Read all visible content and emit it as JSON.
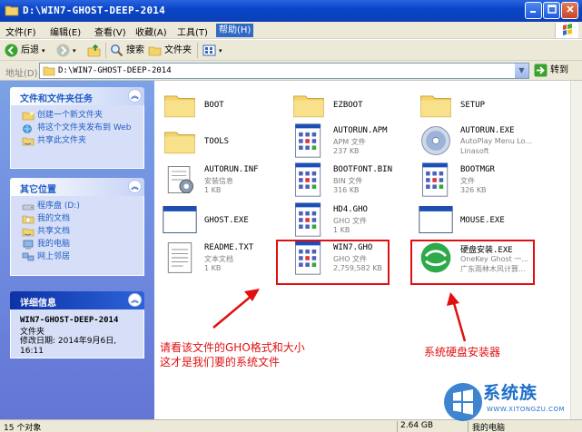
{
  "window": {
    "title": "D:\\WIN7-GHOST-DEEP-2014"
  },
  "menu": [
    "文件(F)",
    "编辑(E)",
    "查看(V)",
    "收藏(A)",
    "工具(T)",
    "帮助(H)"
  ],
  "toolbar": {
    "back": "后退",
    "search": "搜索",
    "folders": "文件夹"
  },
  "address": {
    "label": "地址(D)",
    "value": "D:\\WIN7-GHOST-DEEP-2014",
    "go": "转到"
  },
  "sidebar": {
    "tasks": {
      "title": "文件和文件夹任务",
      "items": [
        "创建一个新文件夹",
        "将这个文件夹发布到 Web",
        "共享此文件夹"
      ],
      "icons": [
        "new-folder-icon",
        "publish-web-icon",
        "share-folder-icon"
      ]
    },
    "places": {
      "title": "其它位置",
      "items": [
        "程序盘 (D:)",
        "我的文档",
        "共享文档",
        "我的电脑",
        "网上邻居"
      ],
      "icons": [
        "drive-icon",
        "my-documents-icon",
        "shared-documents-icon",
        "my-computer-icon",
        "network-places-icon"
      ]
    },
    "details": {
      "title": "详细信息",
      "name": "WIN7-GHOST-DEEP-2014",
      "type": "文件夹",
      "modified": "修改日期: 2014年9月6日, 16:11"
    }
  },
  "files": [
    {
      "name": "BOOT",
      "l2": "",
      "l3": "",
      "icon": "folder"
    },
    {
      "name": "EZBOOT",
      "l2": "",
      "l3": "",
      "icon": "folder"
    },
    {
      "name": "SETUP",
      "l2": "",
      "l3": "",
      "icon": "folder"
    },
    {
      "name": "TOOLS",
      "l2": "",
      "l3": "",
      "icon": "folder"
    },
    {
      "name": "AUTORUN.APM",
      "l2": "APM 文件",
      "l3": "237 KB",
      "icon": "generic-file"
    },
    {
      "name": "AUTORUN.EXE",
      "l2": "AutoPlay Menu Lo...",
      "l3": "Linasoft",
      "icon": "cd"
    },
    {
      "name": "AUTORUN.INF",
      "l2": "安装信息",
      "l3": "1 KB",
      "icon": "setup-info"
    },
    {
      "name": "BOOTFONT.BIN",
      "l2": "BIN 文件",
      "l3": "316 KB",
      "icon": "generic-file"
    },
    {
      "name": "BOOTMGR",
      "l2": "文件",
      "l3": "326 KB",
      "icon": "generic-file"
    },
    {
      "name": "GHOST.EXE",
      "l2": "",
      "l3": "",
      "icon": "exe-window"
    },
    {
      "name": "HD4.GHO",
      "l2": "GHO 文件",
      "l3": "1 KB",
      "icon": "generic-file"
    },
    {
      "name": "MOUSE.EXE",
      "l2": "",
      "l3": "",
      "icon": "exe-window"
    },
    {
      "name": "README.TXT",
      "l2": "文本文档",
      "l3": "1 KB",
      "icon": "text"
    },
    {
      "name": "WIN7.GHO",
      "l2": "GHO 文件",
      "l3": "2,759,582 KB",
      "icon": "generic-file"
    },
    {
      "name": "硬盘安装.EXE",
      "l2": "OneKey Ghost 一...",
      "l3": "广东雨林木风计算...",
      "icon": "onekey"
    }
  ],
  "annotations": {
    "left_line1": "请看该文件的GHO格式和大小",
    "left_line2": "这才是我们要的系统文件",
    "right": "系统硬盘安装器"
  },
  "status": {
    "count": "15 个对象",
    "size": "2.64 GB",
    "zone": "我的电脑"
  },
  "watermark": {
    "brand": "系统族",
    "url": "WWW.XITONGZU.COM"
  },
  "colors": {
    "titlebar": "#0a46c8",
    "sidebar": "#6f8fdf",
    "annotation": "#e01010",
    "link": "#215dc6"
  }
}
